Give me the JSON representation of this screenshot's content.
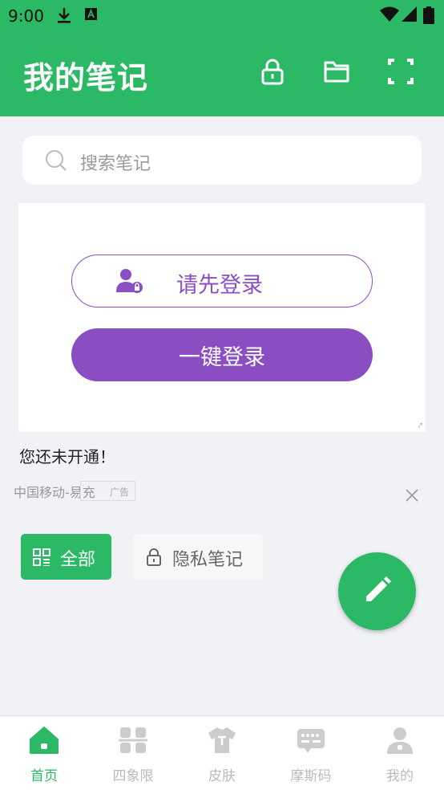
{
  "status_bar": {
    "time": "9:00"
  },
  "app_bar": {
    "title": "我的笔记"
  },
  "search": {
    "placeholder": "搜索笔记"
  },
  "ad": {
    "login_prompt": "请先登录",
    "one_click_login": "一键登录",
    "corner_mark": "⤤"
  },
  "notice": "您还未开通！",
  "ad_source": "中国移动-易充",
  "ad_tag": "广告",
  "tabs": [
    {
      "label": "全部",
      "active": true
    },
    {
      "label": "隐私笔记",
      "active": false
    }
  ],
  "bottom_nav": [
    {
      "label": "首页",
      "icon": "home-icon",
      "active": true
    },
    {
      "label": "四象限",
      "icon": "quadrant-icon",
      "active": false
    },
    {
      "label": "皮肤",
      "icon": "shirt-icon",
      "active": false
    },
    {
      "label": "摩斯码",
      "icon": "morse-icon",
      "active": false
    },
    {
      "label": "我的",
      "icon": "user-icon",
      "active": false
    }
  ],
  "colors": {
    "primary": "#2bb965",
    "purple": "#8b4ec2",
    "background": "#f1f2f6",
    "inactive": "#bbbbbb"
  }
}
